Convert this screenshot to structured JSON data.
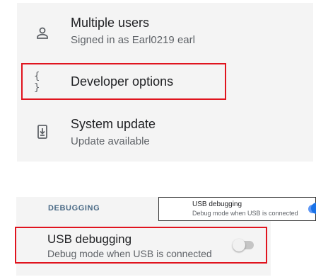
{
  "settings_list": [
    {
      "title": "Multiple users",
      "subtitle": "Signed in as Earl0219 earl",
      "icon": "person-icon"
    },
    {
      "title": "Developer options",
      "icon": "braces-icon"
    },
    {
      "title": "System update",
      "subtitle": "Update available",
      "icon": "system-update-icon"
    }
  ],
  "braces_glyph": "{ }",
  "debugging": {
    "section_label": "DEBUGGING",
    "usb_title": "USB debugging",
    "usb_subtitle": "Debug mode when USB is connected",
    "toggle_state": "off"
  },
  "callout": {
    "title": "USB debugging",
    "subtitle": "Debug mode when USB is connected",
    "toggle_state": "on"
  },
  "colors": {
    "highlight": "#e0141e",
    "accent": "#1a73e8",
    "panel_bg": "#f4f4f4",
    "section_label": "#4a6a86"
  }
}
